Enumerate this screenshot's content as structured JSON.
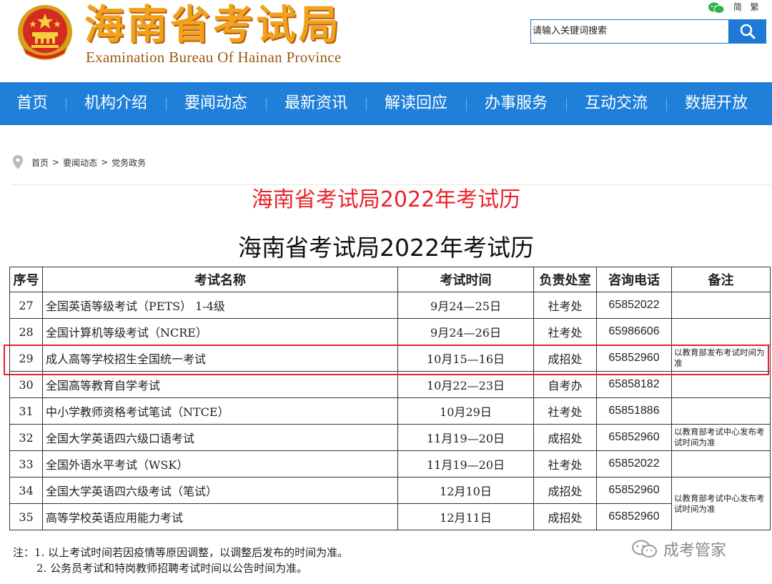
{
  "header": {
    "title": "海南省考试局",
    "subtitle": "Examination Bureau Of Hainan Province",
    "lang_simplified": "简",
    "lang_traditional": "繁",
    "search_placeholder": "请输入关键词搜索"
  },
  "nav": {
    "items": [
      "首页",
      "机构介绍",
      "要闻动态",
      "最新资讯",
      "解读回应",
      "办事服务",
      "互动交流",
      "数据开放"
    ]
  },
  "breadcrumb": {
    "items": [
      "首页",
      "要闻动态",
      "党务政务"
    ],
    "separator": ">"
  },
  "article": {
    "title": "海南省考试局2022年考试历",
    "doc_title": "海南省考试局2022年考试历"
  },
  "table": {
    "headers": [
      "序号",
      "考试名称",
      "考试时间",
      "负责处室",
      "咨询电话",
      "备注"
    ],
    "rows": [
      {
        "no": "27",
        "name": "全国英语等级考试（PETS） 1-4级",
        "time": "9月24—25日",
        "office": "社考处",
        "phone": "65852022",
        "note": ""
      },
      {
        "no": "28",
        "name": "全国计算机等级考试（NCRE）",
        "time": "9月24—26日",
        "office": "社考处",
        "phone": "65986606",
        "note": ""
      },
      {
        "no": "29",
        "name": "成人高等学校招生全国统一考试",
        "time": "10月15—16日",
        "office": "成招处",
        "phone": "65852960",
        "note": "以教育部发布考试时间为准"
      },
      {
        "no": "30",
        "name": "全国高等教育自学考试",
        "time": "10月22—23日",
        "office": "自考办",
        "phone": "65858182",
        "note": ""
      },
      {
        "no": "31",
        "name": "中小学教师资格考试笔试（NTCE）",
        "time": "10月29日",
        "office": "社考处",
        "phone": "65851886",
        "note": ""
      },
      {
        "no": "32",
        "name": "全国大学英语四六级口语考试",
        "time": "11月19—20日",
        "office": "成招处",
        "phone": "65852960",
        "note": "以教育部考试中心发布考试时间为准"
      },
      {
        "no": "33",
        "name": "全国外语水平考试（WSK）",
        "time": "11月19—20日",
        "office": "社考处",
        "phone": "65852022",
        "note": ""
      },
      {
        "no": "34",
        "name": "全国大学英语四六级考试（笔试）",
        "time": "12月10日",
        "office": "成招处",
        "phone": "65852960",
        "note": "以教育部考试中心发布考试时间为准"
      },
      {
        "no": "35",
        "name": "高等学校英语应用能力考试",
        "time": "12月11日",
        "office": "成招处",
        "phone": "65852960",
        "note": ""
      }
    ]
  },
  "notes": {
    "line1": "注：1. 以上考试时间若因疫情等原因调整，以调整后发布的时间为准。",
    "line2": "2. 公务员考试和特岗教师招聘考试时间以公告时间为准。"
  },
  "watermark": "成考管家",
  "colors": {
    "nav_bg": "#1f7fd9",
    "title_red": "#e8232b",
    "brand_orange": "#f0a21c"
  }
}
